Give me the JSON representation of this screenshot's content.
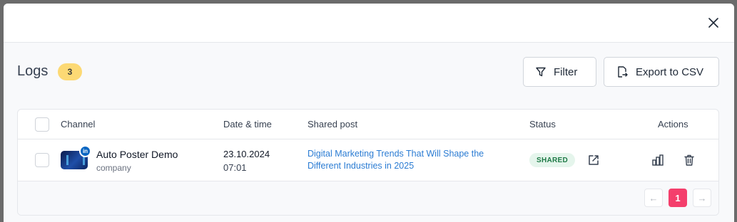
{
  "header": {
    "title": "Logs",
    "count": "3"
  },
  "toolbar": {
    "filter_label": "Filter",
    "export_label": "Export to CSV"
  },
  "table": {
    "columns": [
      "Channel",
      "Date & time",
      "Shared post",
      "Status",
      "Actions"
    ],
    "rows": [
      {
        "channel_name": "Auto Poster Demo",
        "channel_type": "company",
        "network_badge": "in",
        "date": "23.10.2024",
        "time": "07:01",
        "post_title": "Digital Marketing Trends That Will Shape the Different Industries in 2025",
        "status": "SHARED"
      }
    ]
  },
  "pagination": {
    "prev": "←",
    "current": "1",
    "next": "→"
  },
  "colors": {
    "badge": "#fcd974",
    "link": "#2b7cd3",
    "status_bg": "#e5f5ec",
    "status_text": "#1e7a46",
    "page_active": "#f43f6c"
  },
  "icons": [
    "close-icon",
    "filter-icon",
    "export-file-icon",
    "external-link-icon",
    "bar-chart-icon",
    "trash-icon"
  ]
}
